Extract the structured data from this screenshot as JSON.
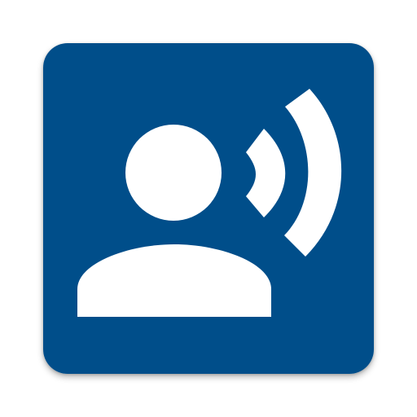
{
  "icon": {
    "name": "voice-selection-icon",
    "background_color": "#004E8A",
    "glyph_color": "#FFFFFF",
    "glyphs": [
      "person-icon",
      "sound-waves-icon"
    ]
  }
}
